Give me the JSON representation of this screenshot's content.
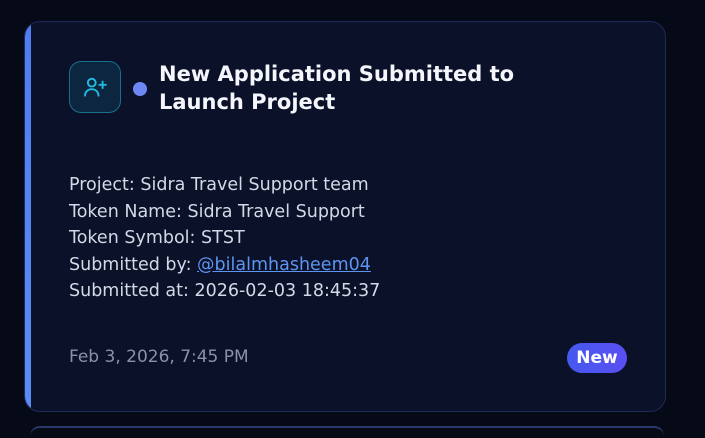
{
  "notification": {
    "title": "New Application Submitted to Launch Project",
    "icon": "user-plus-icon",
    "status_dot_color": "#6d88f5",
    "accent_color": "#4f7df0",
    "details": {
      "project_label": "Project:",
      "project_value": "Sidra Travel Support team",
      "token_name_label": "Token Name:",
      "token_name_value": "Sidra Travel Support",
      "token_symbol_label": "Token Symbol:",
      "token_symbol_value": "STST",
      "submitted_by_label": "Submitted by:",
      "submitted_by_value": "@bilalmhasheem04",
      "submitted_at_label": "Submitted at:",
      "submitted_at_value": "2026-02-03 18:45:37"
    },
    "date": "Feb 3, 2026, 7:45 PM",
    "badge": "New"
  }
}
